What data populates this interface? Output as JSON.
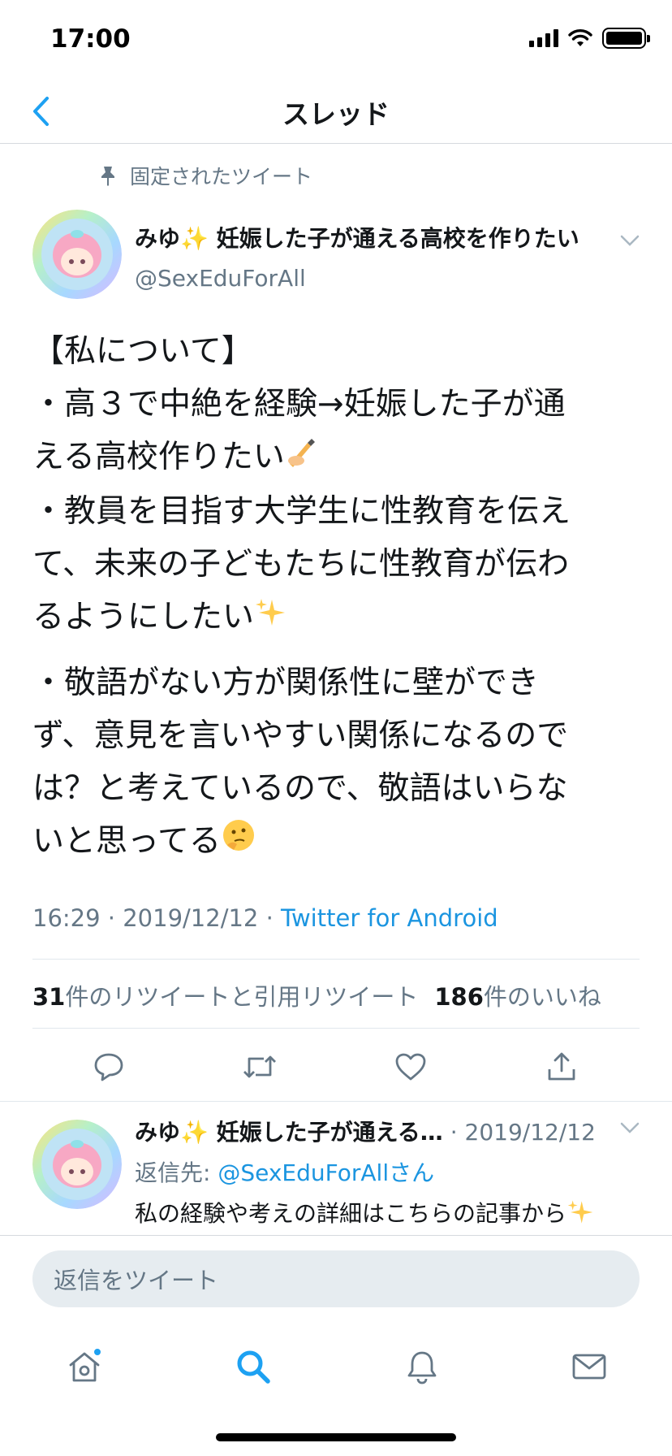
{
  "status_bar": {
    "time": "17:00"
  },
  "nav": {
    "title": "スレッド"
  },
  "pinned_label": "固定されたツイート",
  "tweet": {
    "author_name": "みゆ✨ 妊娠した子が通える高校を作りたい",
    "handle": "@SexEduForAll",
    "paragraphs": [
      {
        "lines": [
          "【私について】",
          "・高３で中絶を経験→妊娠した子が通",
          "える高校作りたい",
          "・教員を目指す大学生に性教育を伝え",
          "て、未来の子どもたちに性教育が伝わ",
          "るようにしたい"
        ]
      },
      {
        "lines": [
          "・敬語がない方が関係性に壁ができ",
          "ず、意見を言いやすい関係になるので",
          "は？と考えているので、敬語はいらな",
          "いと思ってる"
        ]
      }
    ],
    "time": "16:29",
    "date": "2019/12/12",
    "source": "Twitter for Android",
    "retweet_count": "31",
    "retweet_label": "件のリツイートと引用リツイート",
    "like_count": "186",
    "like_label": "件のいいね"
  },
  "icons": {
    "pinned": "pin-icon",
    "reply": "reply-icon",
    "retweet": "retweet-icon",
    "like": "heart-icon",
    "share": "share-icon"
  },
  "reply": {
    "author_name": "みゆ✨ 妊娠した子が通える…",
    "date": "2019/12/12",
    "reply_to_label": "返信先:",
    "reply_to_handle": "@SexEduForAllさん",
    "text": "私の経験や考えの詳細はこちらの記事から"
  },
  "composer": {
    "placeholder": "返信をツイート"
  },
  "colors": {
    "accent": "#1da1f2",
    "link": "#1b95e0",
    "secondary_text": "#657786",
    "icon_gray": "#657786",
    "composer_bg": "#e6ecf0"
  }
}
